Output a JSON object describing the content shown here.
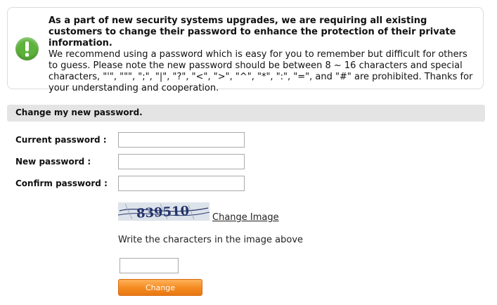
{
  "notice": {
    "icon": "exclamation-icon",
    "icon_color": "#5cb23a",
    "heading": "As a part of new security systems upgrades, we are requiring all existing customers to change their password to enhance the protection of their private information.",
    "body": "We recommend using a password which is easy for you to remember but difficult for others to guess. Please note the new password should be between 8 ~ 16 characters and special characters, \"'\", \"\"\", \";\", \"|\", \"?\", \"<\", \">\", \"^\", \"*\", \":\", \"=\", and \"#\" are prohibited. Thanks for your understanding and cooperation."
  },
  "form": {
    "title": "Change my new password.",
    "current_label": "Current password :",
    "new_label": "New password :",
    "confirm_label": "Confirm password :",
    "captcha_text": "839510",
    "change_image_label": "Change Image",
    "captcha_hint": "Write the characters in the image above",
    "submit_label": "Change",
    "accent_color": "#f48a1f"
  }
}
